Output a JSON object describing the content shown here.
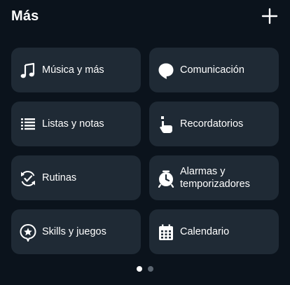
{
  "header": {
    "title": "Más",
    "add_icon": "plus-icon"
  },
  "tiles": [
    {
      "label": "Música y más",
      "icon": "music-note-icon"
    },
    {
      "label": "Comunicación",
      "icon": "speech-bubble-icon"
    },
    {
      "label": "Listas y notas",
      "icon": "list-icon"
    },
    {
      "label": "Recordatorios",
      "icon": "reminder-hand-icon"
    },
    {
      "label": "Rutinas",
      "icon": "routine-check-icon"
    },
    {
      "label": "Alarmas y temporizadores",
      "icon": "alarm-clock-icon"
    },
    {
      "label": "Skills y juegos",
      "icon": "skills-star-icon"
    },
    {
      "label": "Calendario",
      "icon": "calendar-icon"
    }
  ],
  "pagination": {
    "pages": 2,
    "current": 1
  },
  "colors": {
    "background": "#0b131c",
    "tile": "#1f2a35",
    "text": "#ffffff",
    "dot_active": "#ffffff",
    "dot_inactive": "#5b6570"
  }
}
